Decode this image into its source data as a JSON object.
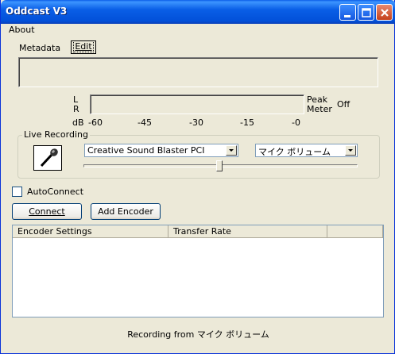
{
  "window": {
    "title": "Oddcast V3"
  },
  "menu": {
    "about": "About"
  },
  "metadata": {
    "label": "Metadata",
    "edit_button": "Edit"
  },
  "meter": {
    "left_channel": "L",
    "right_channel": "R",
    "db_label": "dB",
    "scale": [
      "-60",
      "-45",
      "-30",
      "-15",
      "-0"
    ],
    "peak_line1": "Peak",
    "peak_line2": "Meter",
    "peak_value": "Off"
  },
  "live_recording": {
    "label": "Live Recording",
    "device": "Creative Sound Blaster PCI",
    "input": "マイク ボリューム",
    "volume_level": 0.495
  },
  "autoconnect": {
    "label": "AutoConnect",
    "checked": false
  },
  "buttons": {
    "connect": "Connect",
    "add_encoder": "Add Encoder"
  },
  "encoder_table": {
    "columns": [
      "Encoder Settings",
      "Transfer Rate",
      ""
    ],
    "rows": []
  },
  "status": {
    "text": "Recording from マイク ボリューム"
  },
  "colors": {
    "titlebar": "#0a5fe6",
    "window_bg": "#ece9d8"
  },
  "icons": {
    "mic": "microphone-icon"
  }
}
